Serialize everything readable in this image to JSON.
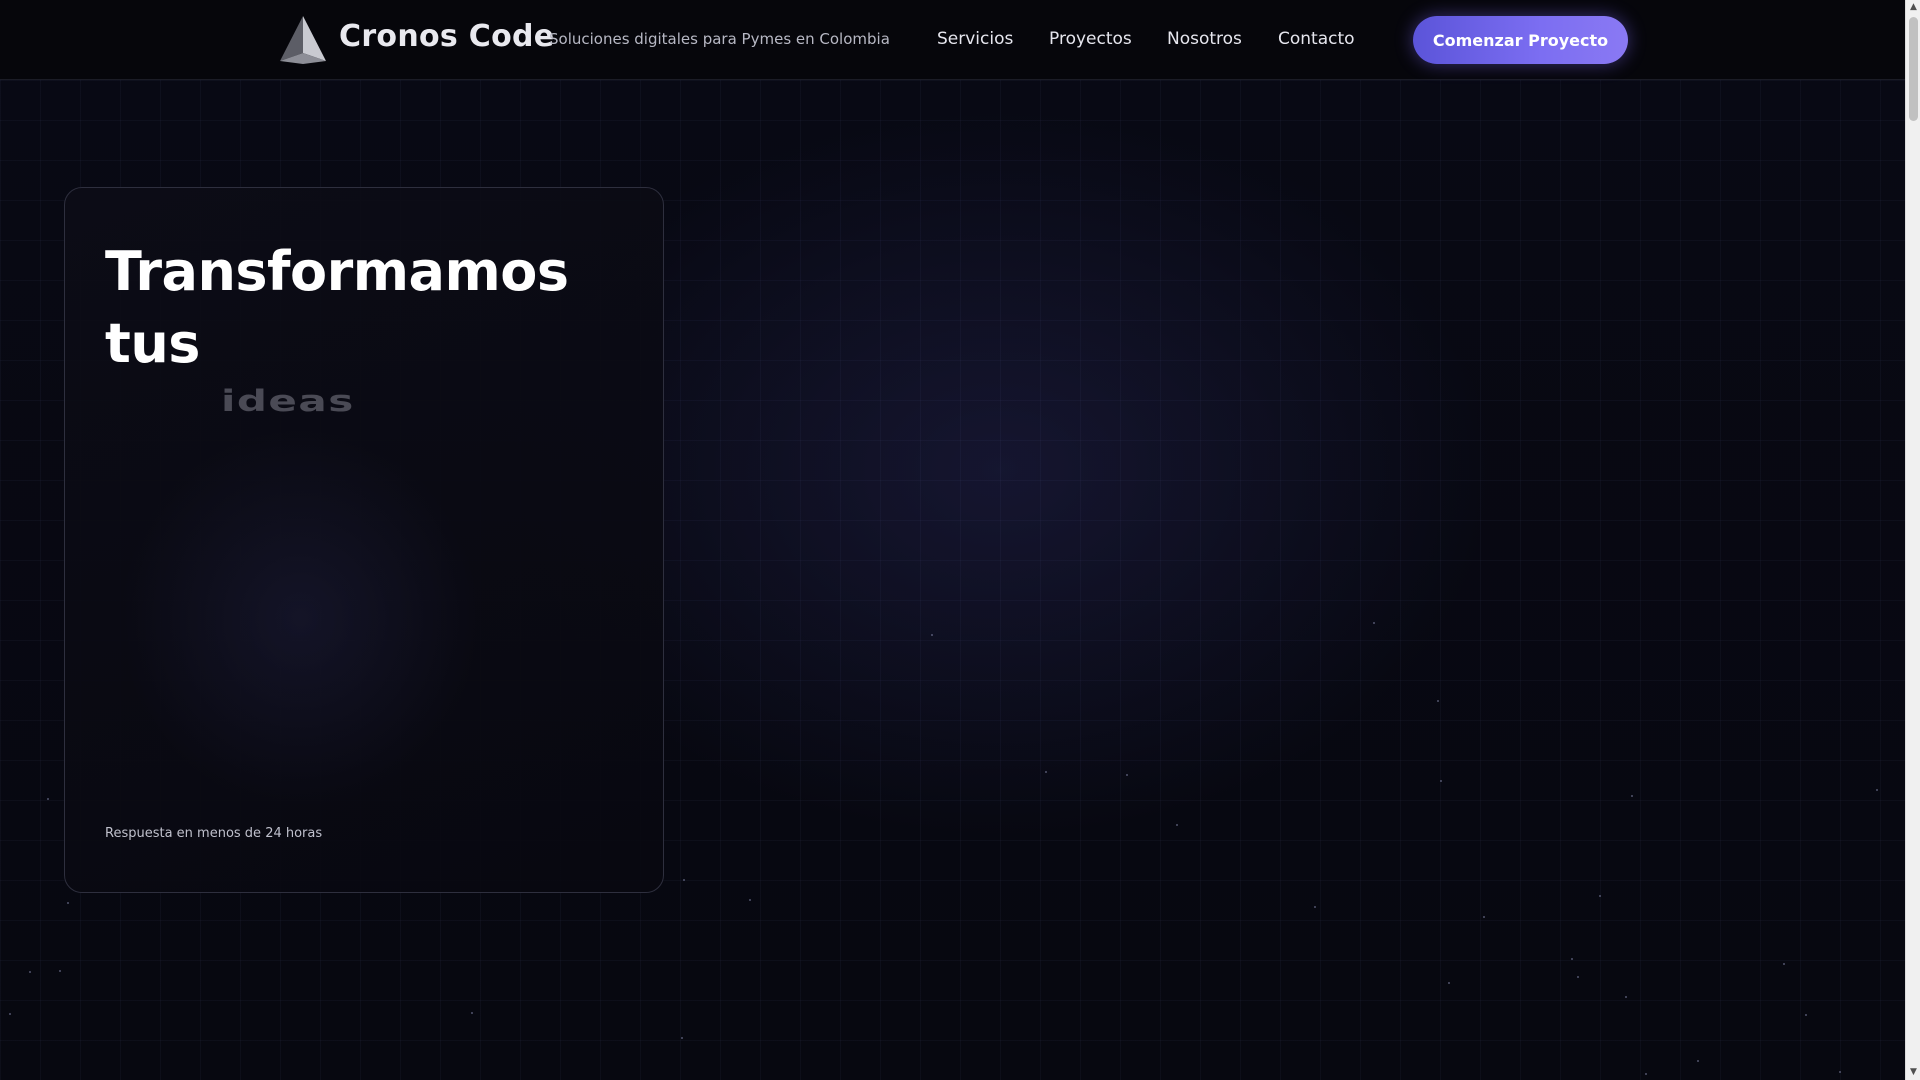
{
  "header": {
    "brand": "Cronos Code",
    "tagline": "Soluciones digitales para Pymes en Colombia",
    "logo_icon": "pyramid-logo-icon",
    "nav": [
      {
        "label": "Servicios"
      },
      {
        "label": "Proyectos"
      },
      {
        "label": "Nosotros"
      },
      {
        "label": "Contacto"
      }
    ],
    "cta_label": "Comenzar Proyecto"
  },
  "hero": {
    "title": "Transformamos tus",
    "rotating_word": "ideas",
    "note": "Respuesta en menos de 24 horas"
  },
  "colors": {
    "background": "#06070d",
    "accent_start": "#5b54d9",
    "accent_end": "#8a79f3",
    "card_border": "#2e2f3e"
  }
}
